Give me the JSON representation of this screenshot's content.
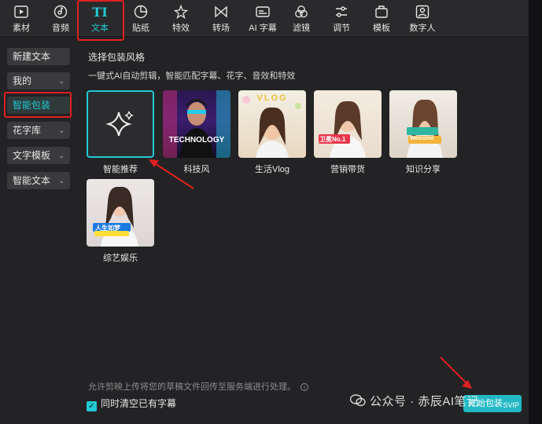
{
  "toolbar": {
    "items": [
      {
        "label": "素材",
        "icon": "media-play-icon"
      },
      {
        "label": "音频",
        "icon": "audio-disc-icon"
      },
      {
        "label": "文本",
        "icon": "text-ti-icon"
      },
      {
        "label": "贴纸",
        "icon": "sticker-icon"
      },
      {
        "label": "特效",
        "icon": "effects-star-icon"
      },
      {
        "label": "转场",
        "icon": "transition-icon"
      },
      {
        "label": "AI 字幕",
        "icon": "ai-subtitle-icon"
      },
      {
        "label": "滤镜",
        "icon": "filter-icon"
      },
      {
        "label": "调节",
        "icon": "adjust-sliders-icon"
      },
      {
        "label": "模板",
        "icon": "template-icon"
      },
      {
        "label": "数字人",
        "icon": "digital-human-icon"
      }
    ],
    "active_index": 2,
    "active_icon_text": "TI"
  },
  "sidebar": {
    "items": [
      {
        "label": "新建文本",
        "chevron": ""
      },
      {
        "label": "我的",
        "chevron": "⌄"
      },
      {
        "label": "智能包装",
        "chevron": ""
      },
      {
        "label": "花字库",
        "chevron": "⌄"
      },
      {
        "label": "文字模板",
        "chevron": "⌄"
      },
      {
        "label": "智能文本",
        "chevron": "⌄"
      }
    ],
    "active_index": 2
  },
  "main": {
    "title": "选择包装风格",
    "description": "一键式AI自动剪辑，智能匹配字幕、花字、音效和特效",
    "styles": [
      {
        "caption": "智能推荐"
      },
      {
        "caption": "科技风",
        "overlay": "TECHNOLOGY"
      },
      {
        "caption": "生活Vlog",
        "overlay": "VLOG"
      },
      {
        "caption": "营销带货",
        "overlay": "卫冕No.1"
      },
      {
        "caption": "知识分享",
        "overlay": "Welcome"
      },
      {
        "caption": "综艺娱乐",
        "overlay": "人生如梦"
      }
    ],
    "footer_note": "允许剪映上传将您的草稿文件回传至服务端进行处理。",
    "info_glyph": "i",
    "checkbox_label": "同时清空已有字幕",
    "checkbox_checked": true,
    "start_button": "开始包装",
    "start_badge": "SVIP"
  },
  "watermark": "公众号 · 赤辰AI笔记",
  "colors": {
    "accent": "#22c9d4",
    "annotation": "#e02020",
    "panel": "#232325",
    "toolbar": "#2a2a2c"
  }
}
